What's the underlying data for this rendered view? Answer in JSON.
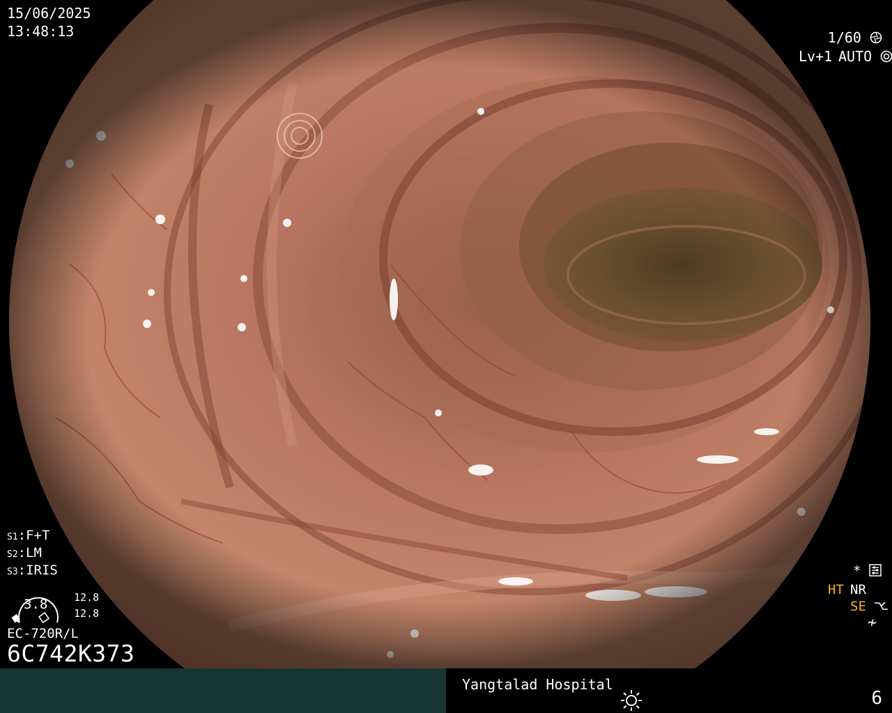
{
  "overlay": {
    "date": "15/06/2025",
    "time": "13:48:13",
    "shutter": "1/60",
    "enhance_level": "Lv+1",
    "exposure_mode": "AUTO",
    "switches": [
      {
        "key": "S1",
        "value": "F+T"
      },
      {
        "key": "S2",
        "value": "LM"
      },
      {
        "key": "S3",
        "value": "IRIS"
      }
    ],
    "iris": {
      "value": "3.8",
      "upper": "12.8",
      "lower": "12.8"
    },
    "scope_model": "EC-720R/L",
    "scope_serial": "6C742K373",
    "indicators": {
      "star": "*",
      "ht": "HT",
      "nr": "NR",
      "se": "SE",
      "nf": "≁"
    }
  },
  "footer": {
    "hospital": "Yangtalad Hospital",
    "page_number": "6"
  },
  "icons": {
    "shutter": "aperture-icon",
    "exposure": "auto-exposure-icon",
    "settings": "settings-sliders-icon",
    "se": "structure-enhance-icon",
    "brightness": "sun-icon"
  },
  "colors": {
    "highlight_indicator": "#ffb020",
    "footer_left": "#163634",
    "mucosa": "#b8735a"
  }
}
